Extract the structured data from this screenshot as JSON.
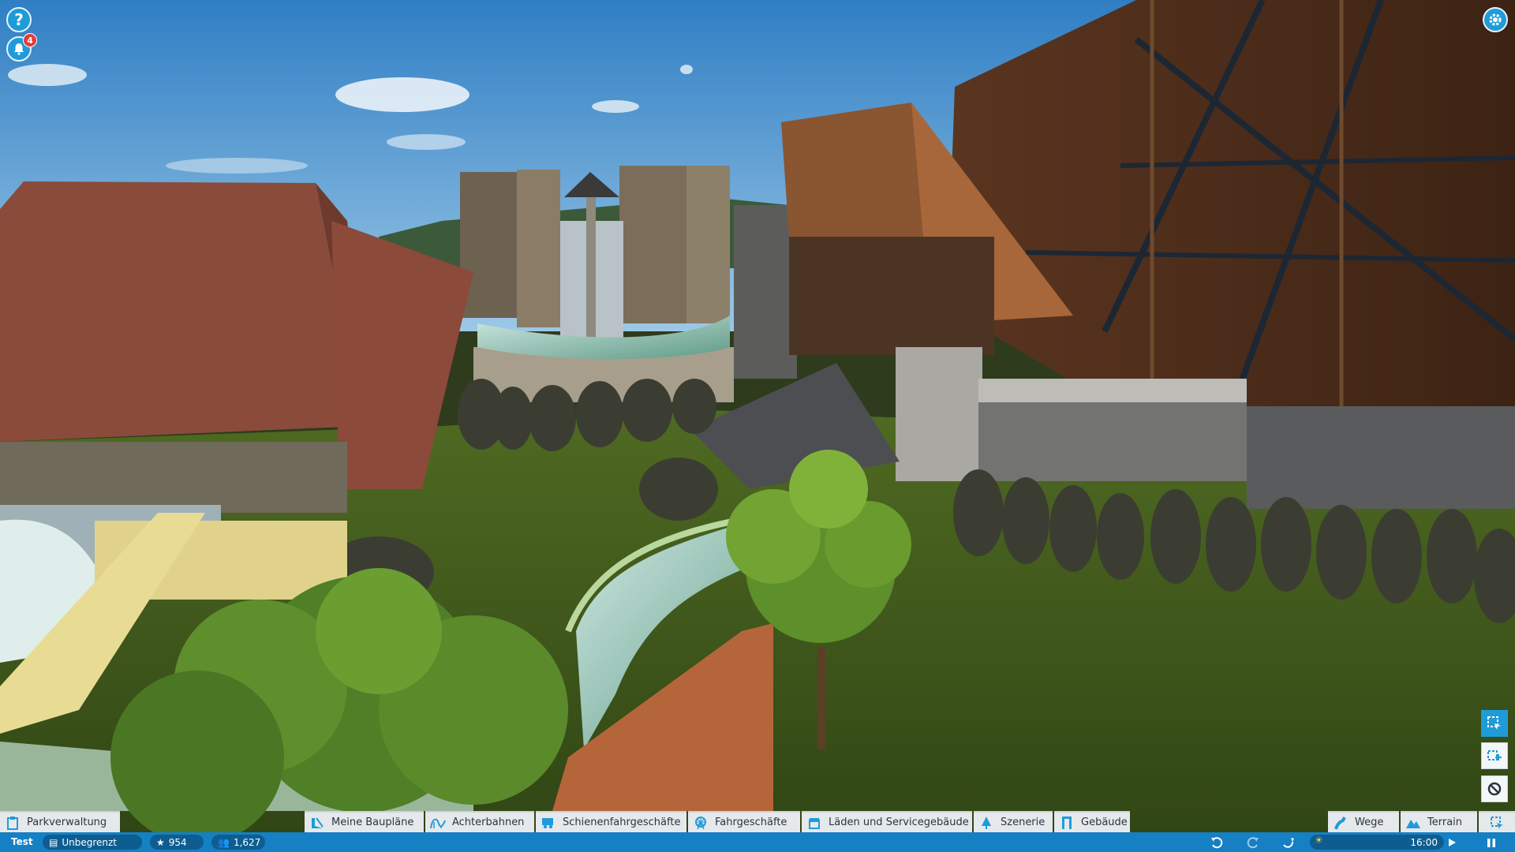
{
  "hud": {
    "help_label": "?",
    "notification_count": "4"
  },
  "toolbar": {
    "left_tab": {
      "label": "Parkverwaltung",
      "icon": "clipboard-icon"
    },
    "tabs": [
      {
        "label": "Meine Baupläne",
        "icon": "blueprint-icon"
      },
      {
        "label": "Achterbahnen",
        "icon": "coaster-icon"
      },
      {
        "label": "Schienenfahrgeschäfte",
        "icon": "train-icon"
      },
      {
        "label": "Fahrgeschäfte",
        "icon": "ferris-wheel-icon"
      },
      {
        "label": "Läden und Servicegebäude",
        "icon": "shop-icon"
      },
      {
        "label": "Szenerie",
        "icon": "tree-icon"
      },
      {
        "label": "Gebäude",
        "icon": "building-icon"
      }
    ],
    "right_tabs": [
      {
        "label": "Wege",
        "icon": "path-icon"
      },
      {
        "label": "Terrain",
        "icon": "terrain-icon"
      }
    ]
  },
  "statusbar": {
    "park_name": "Test",
    "money": "Unbegrenzt",
    "rating": "954",
    "guests": "1,627",
    "time": "16:00"
  },
  "colors": {
    "accent": "#1f9bd9",
    "statusbar": "#1580c4",
    "toolbar_bg": "#e6e9ec"
  }
}
